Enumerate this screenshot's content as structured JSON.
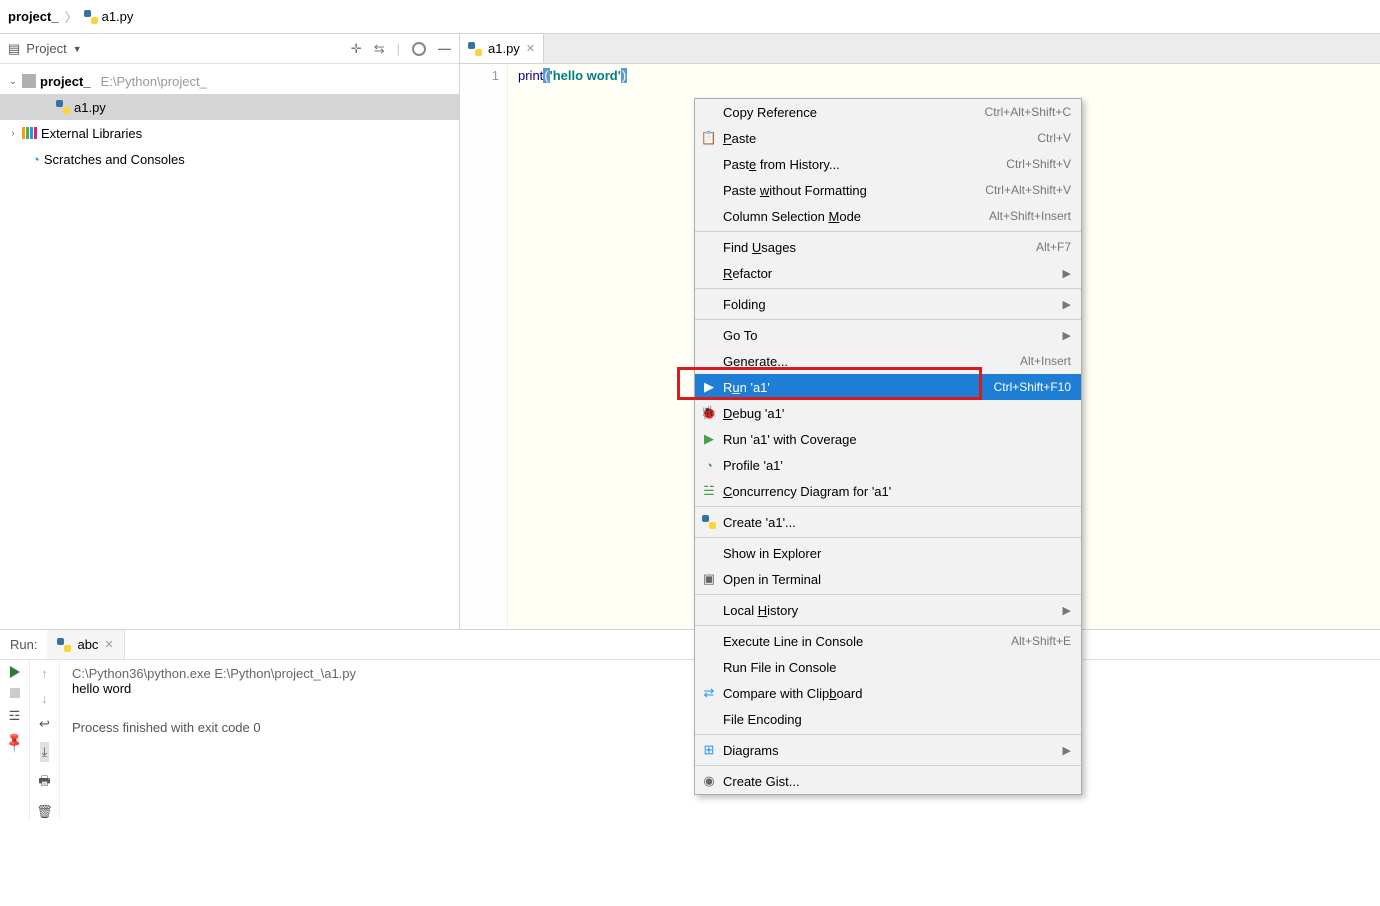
{
  "breadcrumb": {
    "project": "project_",
    "file": "a1.py"
  },
  "sidebar": {
    "title": "Project",
    "nodes": {
      "root": "project_",
      "root_path": "E:\\Python\\project_",
      "file1": "a1.py",
      "ext_lib": "External Libraries",
      "scratches": "Scratches and Consoles"
    }
  },
  "tab": {
    "name": "a1.py"
  },
  "code": {
    "line_no": "1",
    "kw": "print",
    "open": "(",
    "str": "'hello word'",
    "close": ")"
  },
  "context_menu": {
    "copy_ref": "Copy Reference",
    "copy_ref_sc": "Ctrl+Alt+Shift+C",
    "paste": "Paste",
    "paste_sc": "Ctrl+V",
    "paste_hist": "Paste from History...",
    "paste_hist_sc": "Ctrl+Shift+V",
    "paste_wo": "Paste without Formatting",
    "paste_wo_sc": "Ctrl+Alt+Shift+V",
    "col_sel": "Column Selection Mode",
    "col_sel_sc": "Alt+Shift+Insert",
    "find_usages": "Find Usages",
    "find_usages_sc": "Alt+F7",
    "refactor": "Refactor",
    "folding": "Folding",
    "goto": "Go To",
    "generate": "Generate...",
    "generate_sc": "Alt+Insert",
    "run": "Run 'a1'",
    "run_sc": "Ctrl+Shift+F10",
    "debug": "Debug 'a1'",
    "run_cov": "Run 'a1' with Coverage",
    "profile": "Profile 'a1'",
    "concurrency": "Concurrency Diagram for 'a1'",
    "create": "Create 'a1'...",
    "show_explorer": "Show in Explorer",
    "open_terminal": "Open in Terminal",
    "local_history": "Local History",
    "exec_line": "Execute Line in Console",
    "exec_line_sc": "Alt+Shift+E",
    "run_file": "Run File in Console",
    "compare_clip": "Compare with Clipboard",
    "file_enc": "File Encoding",
    "diagrams": "Diagrams",
    "create_gist": "Create Gist..."
  },
  "run": {
    "label": "Run:",
    "tab": "abc",
    "cmd": "C:\\Python36\\python.exe E:\\Python\\project_\\a1.py",
    "out": "hello word",
    "exit": "Process finished with exit code 0"
  }
}
